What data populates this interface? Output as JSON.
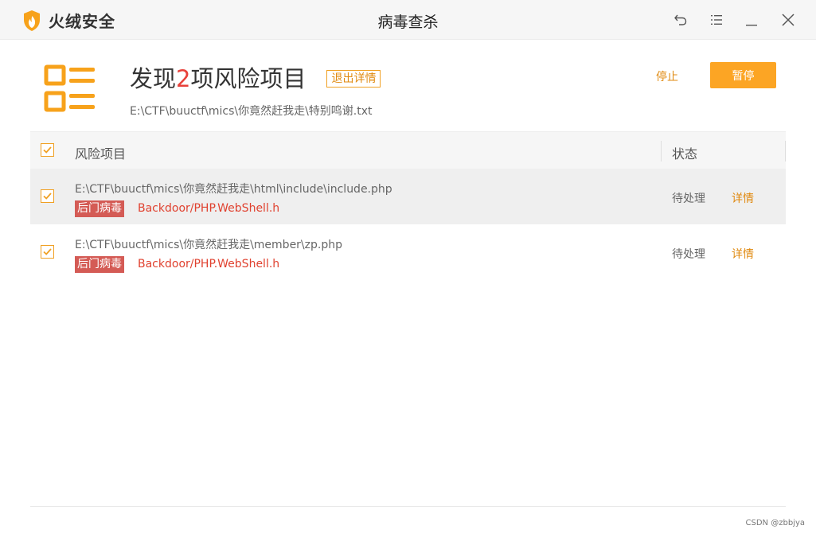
{
  "app": {
    "brand_name": "火绒安全",
    "window_title": "病毒查杀"
  },
  "window_controls": {
    "back_icon": "undo-arrow",
    "menu_icon": "list-menu",
    "minimize_icon": "minus",
    "close_icon": "x"
  },
  "header": {
    "headline_prefix": "发现",
    "risk_count": "2",
    "headline_suffix": "项风险项目",
    "exit_detail_label": "退出详情",
    "current_scan_path": "E:\\CTF\\buuctf\\mics\\你竟然赶我走\\特别鸣谢.txt",
    "stop_label": "停止",
    "pause_label": "暂停"
  },
  "table": {
    "select_all_checked": true,
    "col_name": "风险项目",
    "col_status": "状态",
    "rows": [
      {
        "checked": true,
        "path": "E:\\CTF\\buuctf\\mics\\你竟然赶我走\\html\\include\\include.php",
        "tag": "后门病毒",
        "virus": "Backdoor/PHP.WebShell.h",
        "status": "待处理",
        "detail": "详情"
      },
      {
        "checked": true,
        "path": "E:\\CTF\\buuctf\\mics\\你竟然赶我走\\member\\zp.php",
        "tag": "后门病毒",
        "virus": "Backdoor/PHP.WebShell.h",
        "status": "待处理",
        "detail": "详情"
      }
    ]
  },
  "colors": {
    "accent": "#fca524",
    "accent_text": "#e08a10",
    "risk_red": "#e8413a",
    "tag_bg": "#d45b55"
  },
  "watermark": "CSDN @zbbjya"
}
